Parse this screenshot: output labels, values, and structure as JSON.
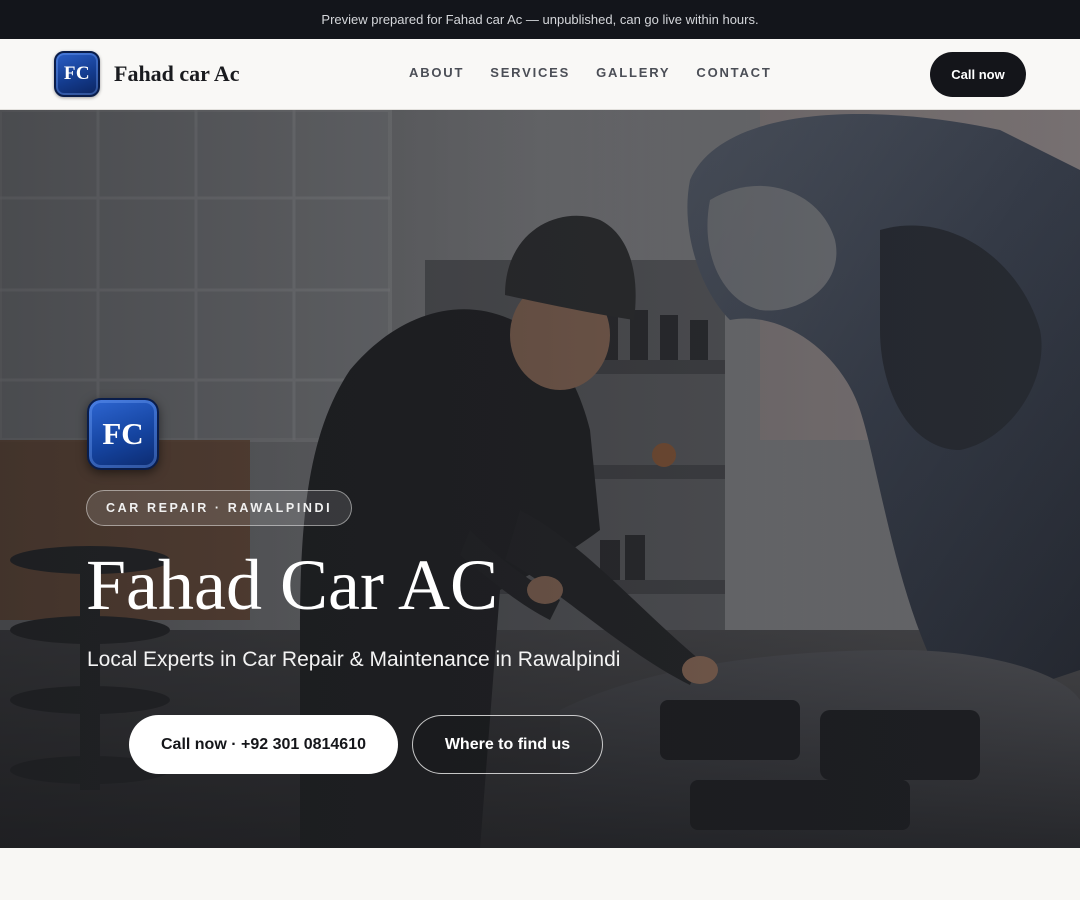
{
  "banner": {
    "text": "Preview prepared for Fahad car Ac — unpublished, can go live within hours."
  },
  "header": {
    "logo_initials": "FC",
    "brand_name": "Fahad car Ac",
    "nav": [
      {
        "label": "ABOUT"
      },
      {
        "label": "SERVICES"
      },
      {
        "label": "GALLERY"
      },
      {
        "label": "CONTACT"
      }
    ],
    "call_button": "Call now"
  },
  "hero": {
    "logo_initials": "FC",
    "eyebrow": "CAR REPAIR · RAWALPINDI",
    "title": "Fahad Car AC",
    "subtitle": "Local Experts in Car Repair & Maintenance in Rawalpindi",
    "cta_primary": "Call now · +92 301 0814610",
    "cta_secondary": "Where to find us",
    "image_icon": "mechanic-photo"
  },
  "colors": {
    "banner_bg": "#13151b",
    "accent_dark": "#14151a",
    "logo_blue": "#1544a0",
    "page_bg": "#f8f7f4"
  }
}
